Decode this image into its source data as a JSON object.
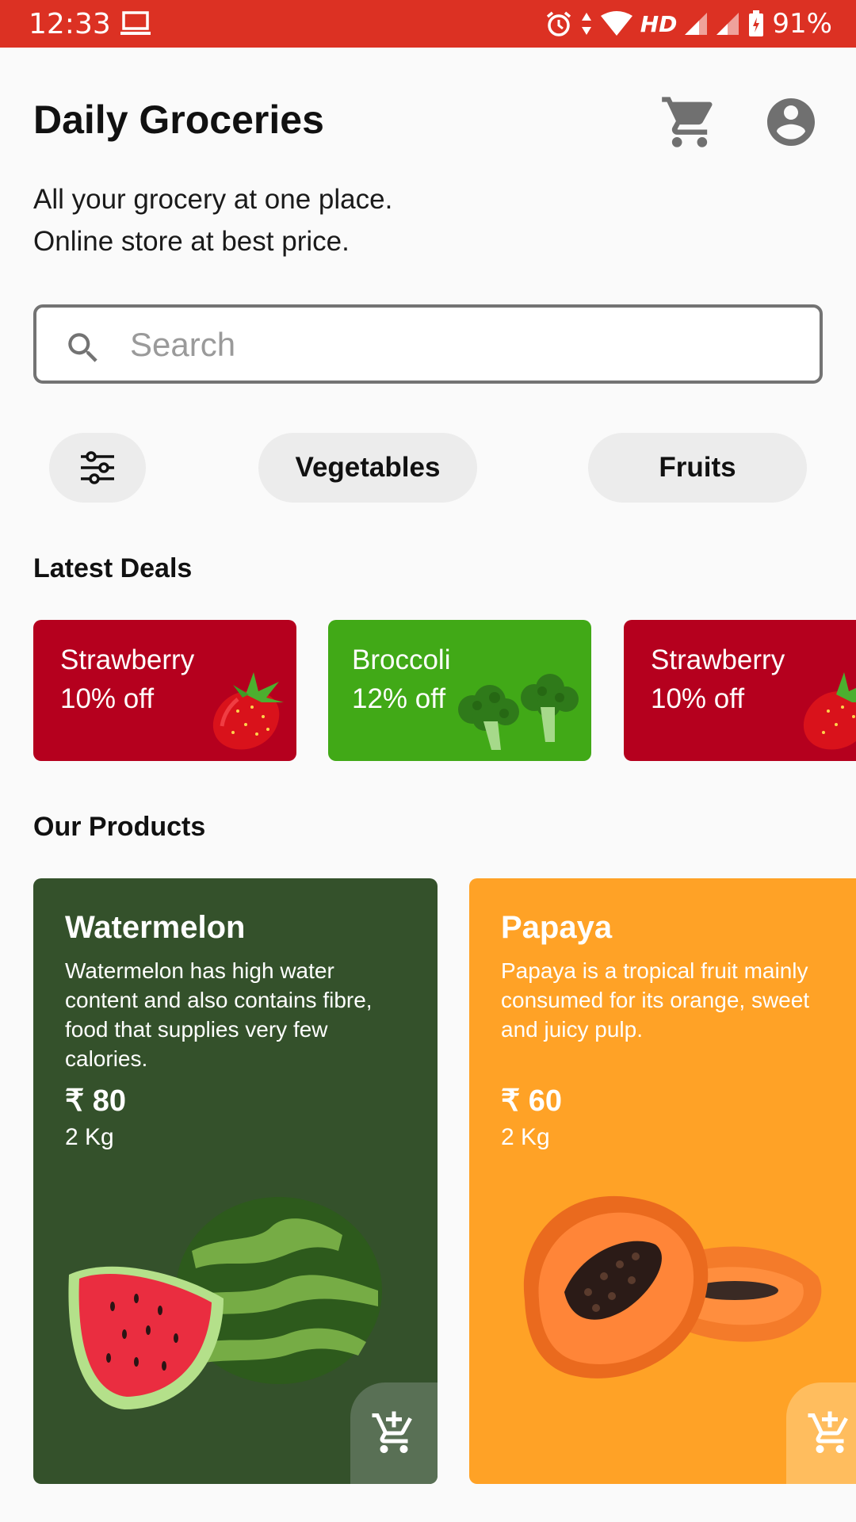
{
  "status_bar": {
    "time": "12:33",
    "hd_label": "HD",
    "battery_percent": "91%",
    "background_color": "#dc3123"
  },
  "header": {
    "title": "Daily Groceries",
    "subtitle_line1": "All your grocery at one place.",
    "subtitle_line2": "Online store at best price."
  },
  "search": {
    "placeholder": "Search",
    "value": ""
  },
  "filters": {
    "chips": [
      {
        "label": "Vegetables"
      },
      {
        "label": "Fruits"
      }
    ]
  },
  "deals": {
    "title": "Latest Deals",
    "items": [
      {
        "name": "Strawberry",
        "discount": "10% off",
        "color": "#b5001e"
      },
      {
        "name": "Broccoli",
        "discount": "12% off",
        "color": "#41a917"
      },
      {
        "name": "Strawberry",
        "discount": "10% off",
        "color": "#b5001e"
      }
    ]
  },
  "products": {
    "title": "Our Products",
    "items": [
      {
        "name": "Watermelon",
        "description": "Watermelon has high water content and also contains fibre, food that supplies very few calories.",
        "price": "₹ 80",
        "quantity": "2 Kg",
        "color": "#34512b"
      },
      {
        "name": "Papaya",
        "description": "Papaya is a tropical fruit mainly consumed for its orange, sweet and juicy pulp.",
        "price": "₹ 60",
        "quantity": "2 Kg",
        "color": "#ffa226"
      }
    ]
  },
  "icons": {
    "cart": "shopping-cart-icon",
    "profile": "account-circle-icon",
    "search": "search-icon",
    "filter": "tune-icon",
    "add_to_cart": "add-shopping-cart-icon"
  }
}
